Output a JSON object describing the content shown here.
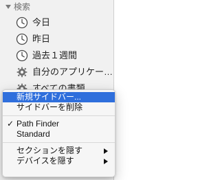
{
  "sidebar": {
    "section_title": "検索",
    "items": [
      {
        "label": "今日",
        "icon": "clock-icon"
      },
      {
        "label": "昨日",
        "icon": "clock-icon"
      },
      {
        "label": "過去１週間",
        "icon": "clock-icon"
      },
      {
        "label": "自分のアプリケー…",
        "icon": "gear-icon"
      },
      {
        "label": "すべての書類",
        "icon": "gear-icon"
      }
    ]
  },
  "context_menu": {
    "items": [
      {
        "label": "新規サイドバー...",
        "highlighted": true
      },
      {
        "label": "サイドバーを削除"
      },
      {
        "separator": true
      },
      {
        "label": "Path Finder",
        "checked": true
      },
      {
        "label": "Standard"
      },
      {
        "separator": true
      },
      {
        "label": "セクションを隠す",
        "submenu": true
      },
      {
        "label": "デバイスを隠す",
        "submenu": true
      }
    ]
  },
  "colors": {
    "highlight": "#2f6fdc",
    "sidebar_bg": "#f1f1f1"
  }
}
